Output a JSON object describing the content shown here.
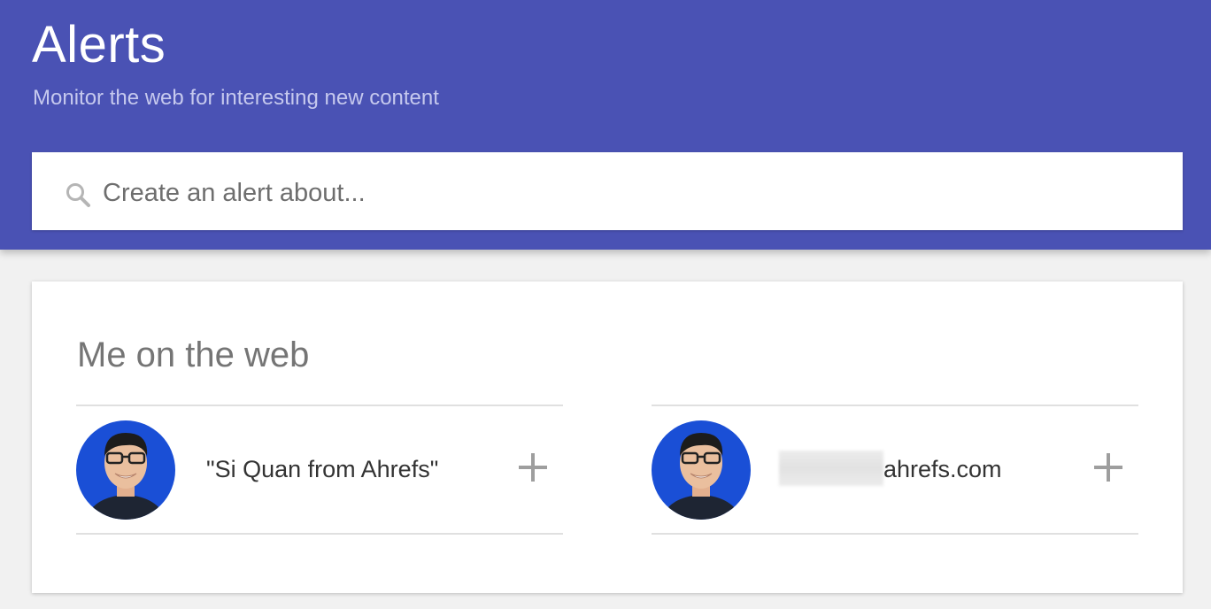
{
  "header": {
    "title": "Alerts",
    "subtitle": "Monitor the web for interesting new content",
    "background_color": "#4a52b4"
  },
  "search": {
    "placeholder": "Create an alert about...",
    "icon": "search-icon"
  },
  "me_on_web": {
    "title": "Me on the web",
    "items": [
      {
        "label": "\"Si Quan from Ahrefs\"",
        "avatar": "avatar",
        "action_icon": "plus-icon"
      },
      {
        "label": "ahrefs.com",
        "avatar": "avatar",
        "action_icon": "plus-icon"
      }
    ]
  }
}
